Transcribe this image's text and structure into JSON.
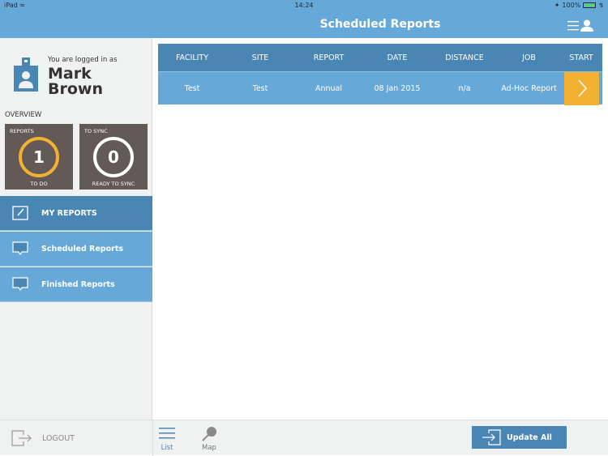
{
  "status_bar": {
    "device": "iPad",
    "time": "14:24",
    "battery": "100%"
  },
  "header": {
    "title": "Scheduled Reports",
    "menu_icon": "menu-user-icon"
  },
  "profile": {
    "logged_in_label": "You are logged in as",
    "first_name": "Mark",
    "last_name": "Brown"
  },
  "overview": {
    "label": "OVERVIEW",
    "tiles": [
      {
        "top_label": "REPORTS",
        "count": "1",
        "bottom_label": "TO DO",
        "ring_color": "#f3b132"
      },
      {
        "top_label": "TO SYNC",
        "count": "0",
        "bottom_label": "READY TO SYNC",
        "ring_color": "#ffffff"
      }
    ]
  },
  "nav": [
    {
      "label": "MY REPORTS",
      "icon": "edit-icon",
      "active": true
    },
    {
      "label": "Scheduled Reports",
      "icon": "speech-bubble-icon",
      "active": false
    },
    {
      "label": "Finished Reports",
      "icon": "speech-bubble-icon",
      "active": false
    }
  ],
  "table": {
    "columns": [
      "FACILITY",
      "SITE",
      "REPORT",
      "DATE",
      "DISTANCE",
      "JOB",
      "START"
    ],
    "rows": [
      {
        "facility": "Test",
        "site": "Test",
        "report": "Annual",
        "date": "08 Jan 2015",
        "distance": "n/a",
        "job": "Ad-Hoc Report"
      }
    ]
  },
  "bottom": {
    "logout": "LOGOUT",
    "tabs": [
      {
        "label": "List",
        "active": true
      },
      {
        "label": "Map",
        "active": false
      }
    ],
    "update_all": "Update All"
  },
  "colors": {
    "primary": "#66a8d8",
    "dark_primary": "#4a86b3",
    "accent": "#f3b132",
    "tile_bg": "#635a57"
  }
}
